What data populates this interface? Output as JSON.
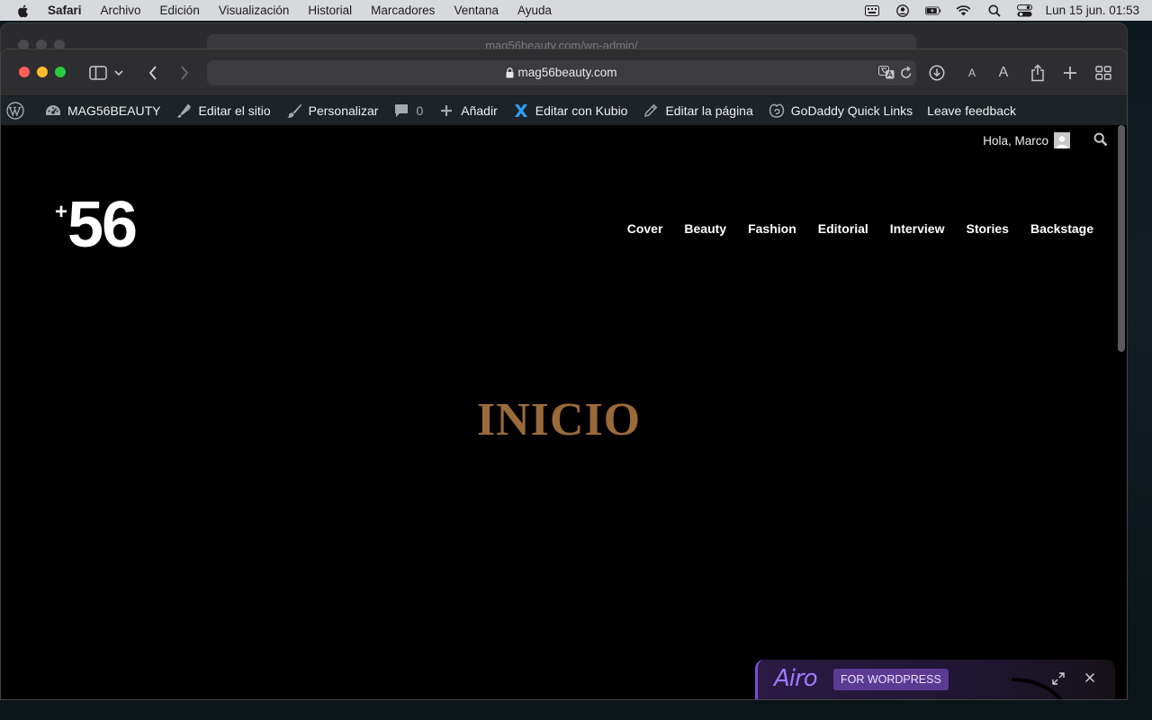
{
  "menubar": {
    "app_name": "Safari",
    "items": [
      "Archivo",
      "Edición",
      "Visualización",
      "Historial",
      "Marcadores",
      "Ventana",
      "Ayuda"
    ],
    "clock": "Lun 15 jun.  01:53"
  },
  "background_window": {
    "url": "mag56beauty.com/wp-admin/"
  },
  "browser": {
    "url": "mag56beauty.com"
  },
  "adminbar": {
    "site_name": "MAG56BEAUTY",
    "edit_site": "Editar el sitio",
    "customize": "Personalizar",
    "comments_count": "0",
    "add_new": "Añadir",
    "edit_kubio": "Editar con Kubio",
    "edit_page": "Editar la página",
    "godaddy": "GoDaddy Quick Links",
    "feedback": "Leave feedback"
  },
  "page": {
    "greeting": "Hola, Marco",
    "logo_plus": "+",
    "logo_number": "56",
    "nav": [
      "Cover",
      "Beauty",
      "Fashion",
      "Editorial",
      "Interview",
      "Stories",
      "Backstage"
    ],
    "hero_title": "INICIO"
  },
  "airo": {
    "brand": "Airo",
    "badge": "FOR WORDPRESS"
  },
  "colors": {
    "hero_title": "#9a6a3a",
    "adminbar_bg": "#1d2327",
    "airo_accent": "#7b4bd6"
  }
}
